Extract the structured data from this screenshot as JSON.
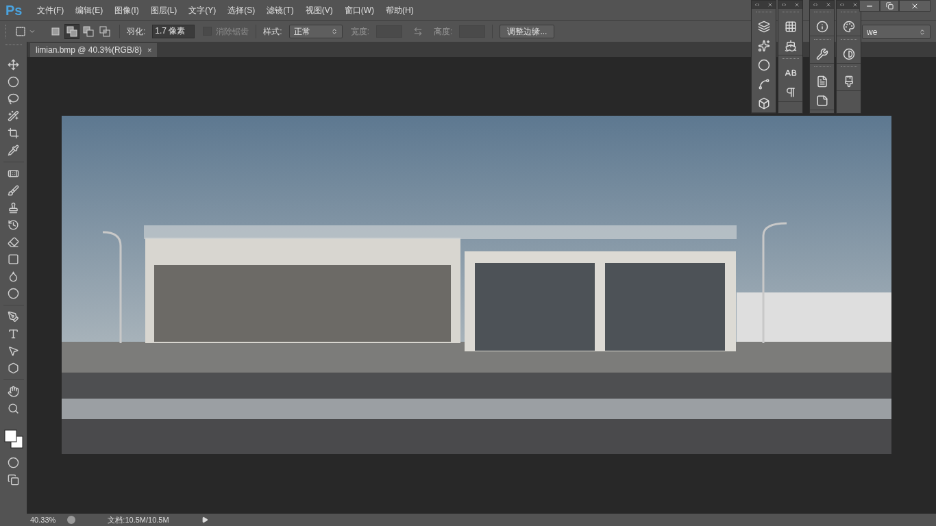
{
  "menu_bar": {
    "logo": "Ps",
    "items": [
      "文件(F)",
      "编辑(E)",
      "图像(I)",
      "图层(L)",
      "文字(Y)",
      "选择(S)",
      "滤镜(T)",
      "视图(V)",
      "窗口(W)",
      "帮助(H)"
    ]
  },
  "options_bar": {
    "selection_modes": [
      {
        "kind": "new",
        "selected": false
      },
      {
        "kind": "add",
        "selected": true
      },
      {
        "kind": "subtract",
        "selected": false
      },
      {
        "kind": "intersect",
        "selected": false
      }
    ],
    "feather": {
      "label": "羽化:",
      "value": "1.7 像素"
    },
    "anti_alias": {
      "label": "消除锯齿",
      "checked": false,
      "disabled": true
    },
    "style": {
      "label": "样式:",
      "value": "正常"
    },
    "width": {
      "label": "宽度:"
    },
    "height": {
      "label": "高度:"
    },
    "refine_button": "调整边缘...",
    "workspace": {
      "value": "we"
    }
  },
  "document_tab": {
    "title": "limian.bmp @ 40.3%(RGB/8)",
    "close": "×"
  },
  "status_bar": {
    "zoom": "40.33%",
    "doc_size": "文档:10.5M/10.5M"
  }
}
